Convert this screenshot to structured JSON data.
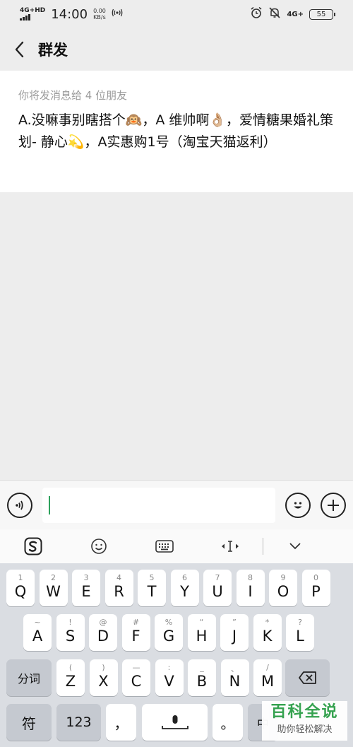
{
  "status_bar": {
    "network_left": "4G+HD",
    "time": "14:00",
    "speed_value": "0.00",
    "speed_unit": "KB/s",
    "network_right": "4G+",
    "battery": "55"
  },
  "header": {
    "title": "群发"
  },
  "card": {
    "hint": "你将发消息给 4 位朋友",
    "message": "A.没嘛事别瞎搭个🙉，A   维帅啊👌🏼，爱情糖果婚礼策划- 静心💫，A实惠购1号（淘宝天猫返利）"
  },
  "input": {
    "value": ""
  },
  "keyboard": {
    "row1": [
      {
        "sub": "1",
        "main": "Q"
      },
      {
        "sub": "2",
        "main": "W"
      },
      {
        "sub": "3",
        "main": "E"
      },
      {
        "sub": "4",
        "main": "R"
      },
      {
        "sub": "5",
        "main": "T"
      },
      {
        "sub": "6",
        "main": "Y"
      },
      {
        "sub": "7",
        "main": "U"
      },
      {
        "sub": "8",
        "main": "I"
      },
      {
        "sub": "9",
        "main": "O"
      },
      {
        "sub": "0",
        "main": "P"
      }
    ],
    "row2": [
      {
        "sub": "~",
        "main": "A"
      },
      {
        "sub": "!",
        "main": "S"
      },
      {
        "sub": "@",
        "main": "D"
      },
      {
        "sub": "#",
        "main": "F"
      },
      {
        "sub": "%",
        "main": "G"
      },
      {
        "sub": "“",
        "main": "H"
      },
      {
        "sub": "”",
        "main": "J"
      },
      {
        "sub": "*",
        "main": "K"
      },
      {
        "sub": "?",
        "main": "L"
      }
    ],
    "row3": [
      {
        "sub": "(",
        "main": "Z"
      },
      {
        "sub": ")",
        "main": "X"
      },
      {
        "sub": "—",
        "main": "C"
      },
      {
        "sub": ":",
        "main": "V"
      },
      {
        "sub": "_",
        "main": "B"
      },
      {
        "sub": "、",
        "main": "N"
      },
      {
        "sub": "/",
        "main": "M"
      }
    ],
    "fenci": "分词",
    "fu": "符",
    "num": "123",
    "comma": "，",
    "period": "。",
    "zhong": "中"
  },
  "watermark": {
    "line1": "百科全说",
    "line2": "助你轻松解决"
  }
}
